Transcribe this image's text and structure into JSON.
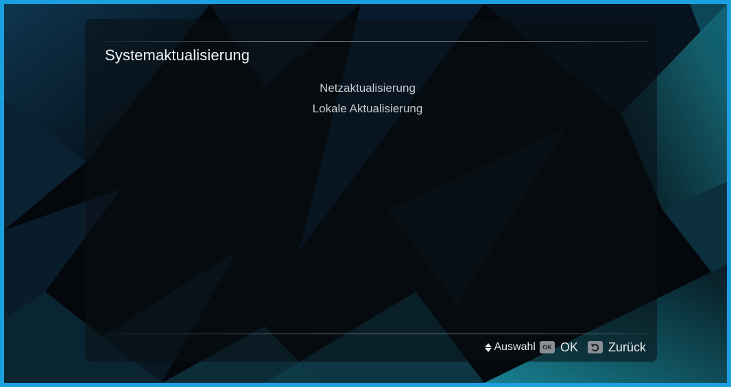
{
  "screen": {
    "title": "Systemaktualisierung",
    "accent_color": "#1aa0de"
  },
  "menu": {
    "items": [
      {
        "label": "Netzaktualisierung"
      },
      {
        "label": "Lokale Aktualisierung"
      }
    ]
  },
  "footer": {
    "select_icon": "up-down-arrows-icon",
    "select_label": "Auswahl",
    "ok_key": "OK",
    "ok_label": "OK",
    "back_icon": "back-arrow-icon",
    "back_label": "Zurück"
  }
}
